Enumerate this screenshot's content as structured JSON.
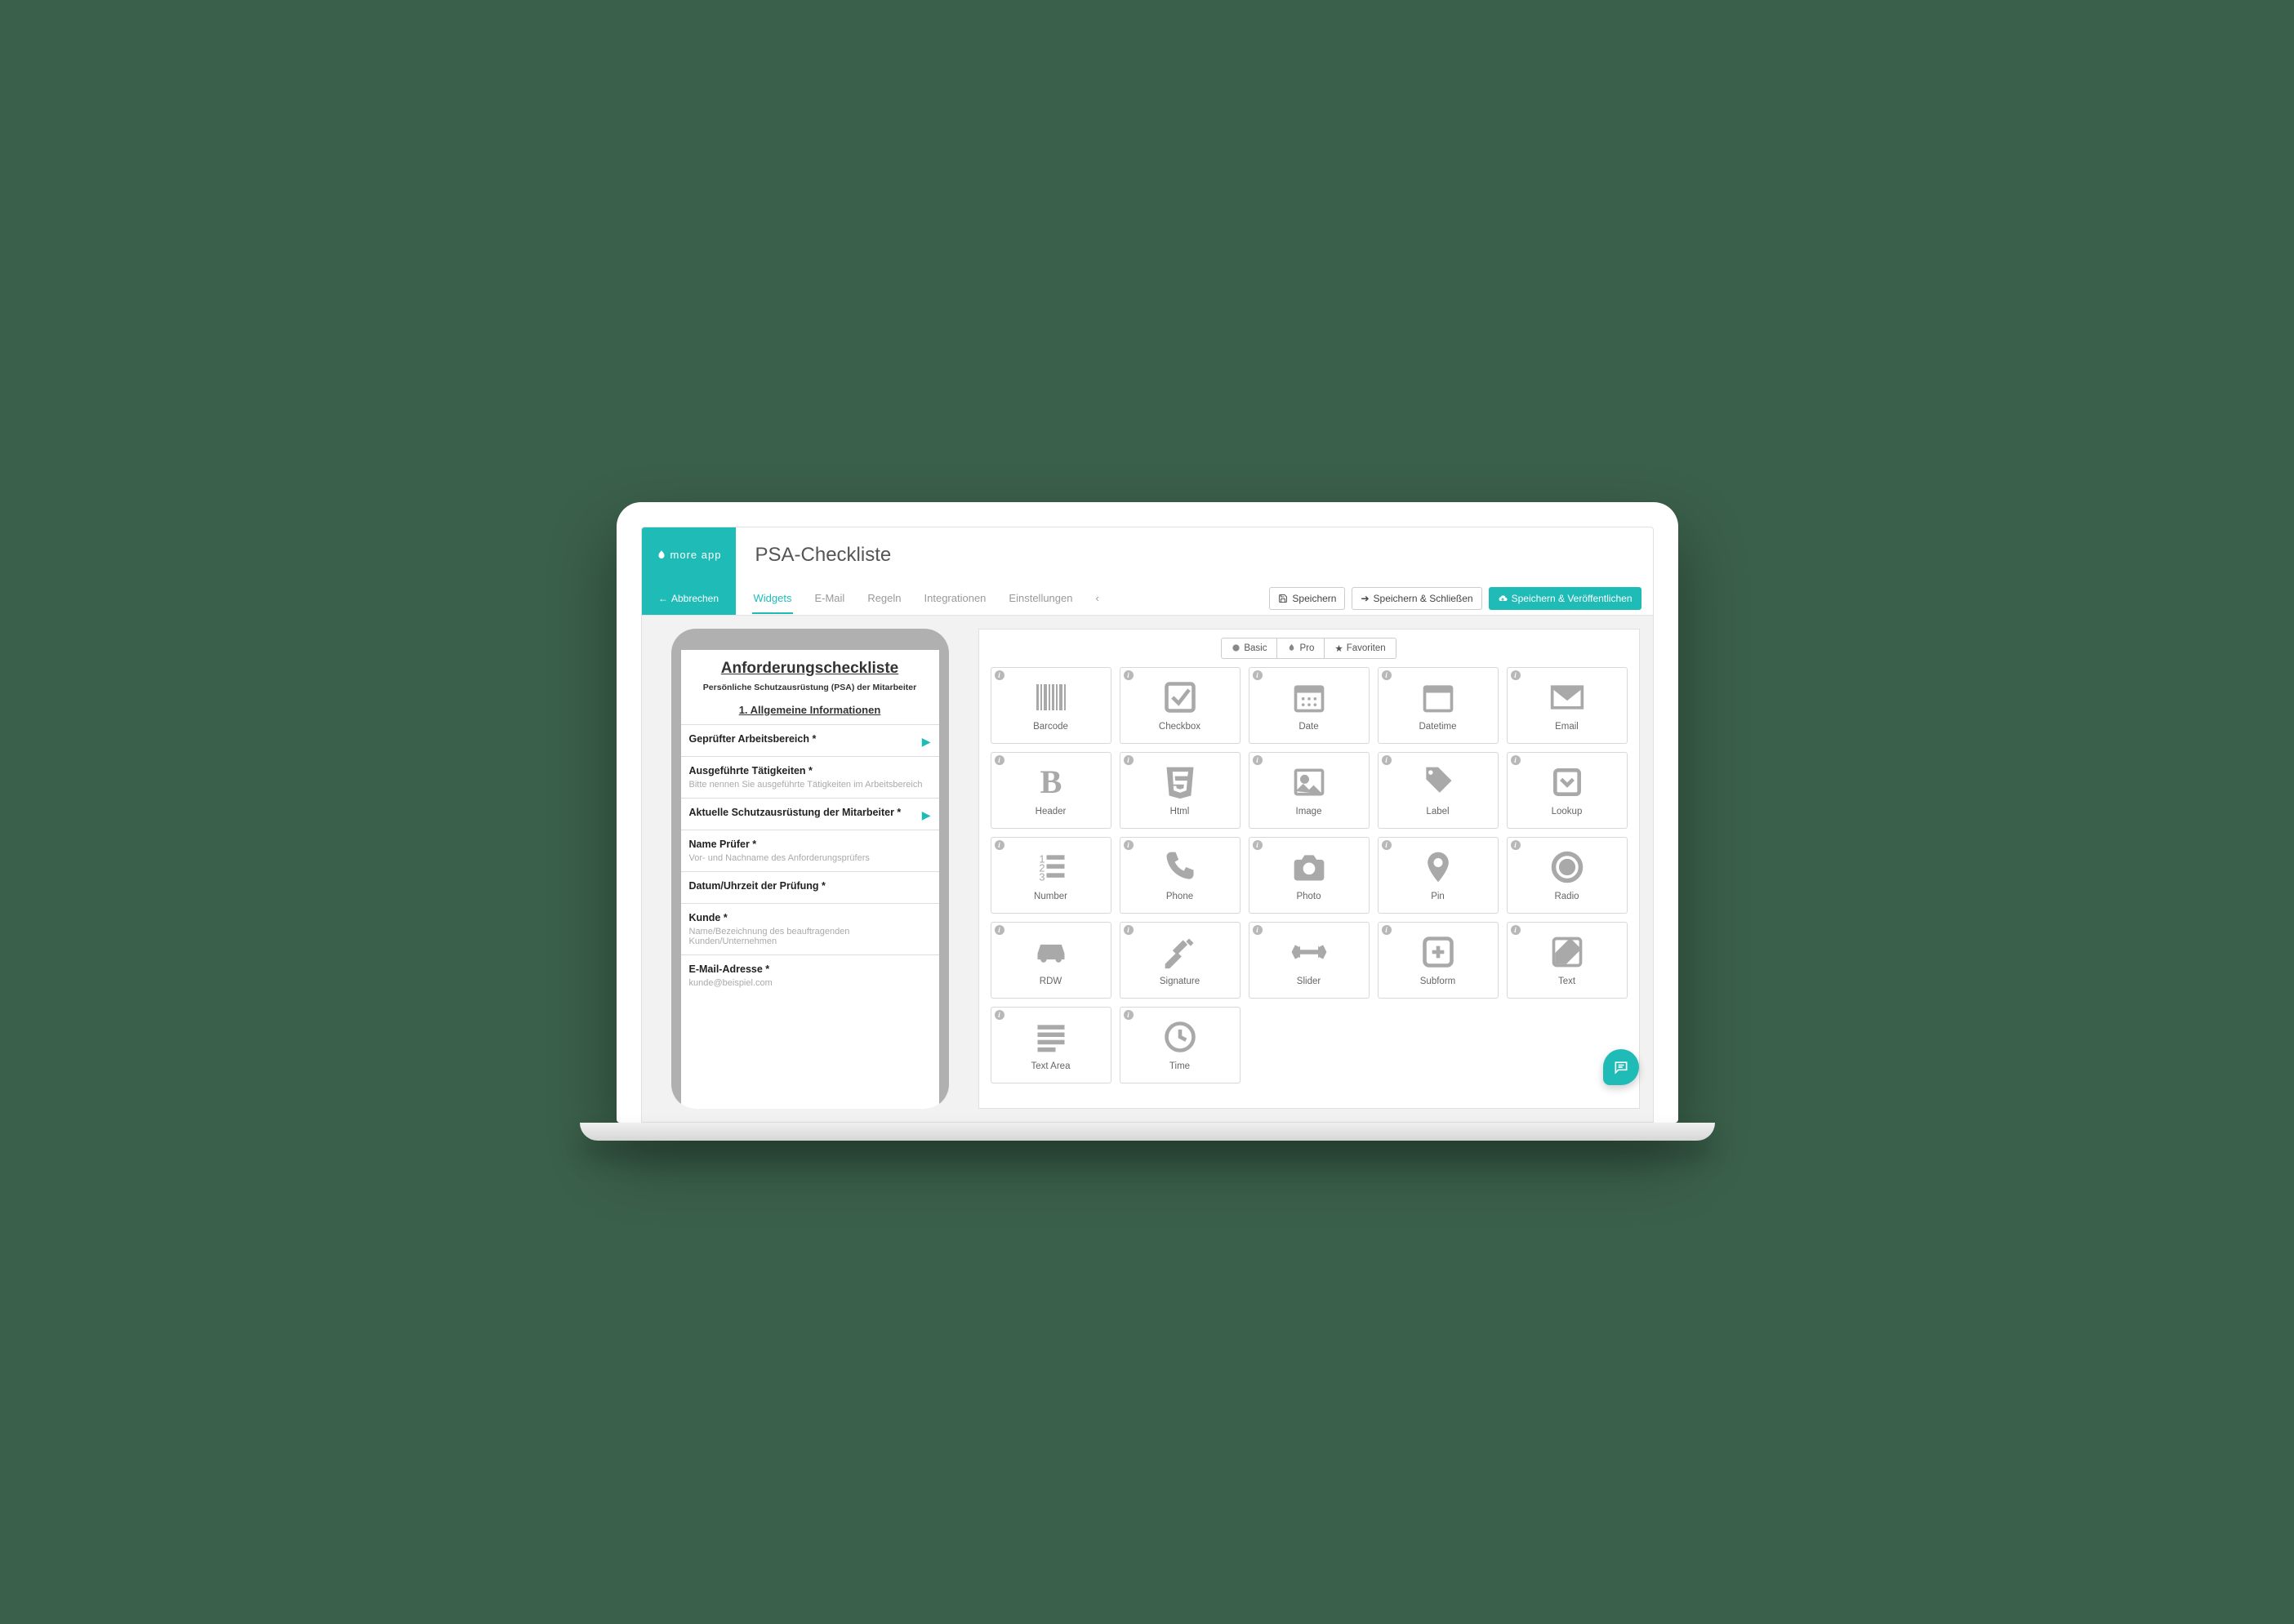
{
  "brand": "more app",
  "page_title": "PSA-Checkliste",
  "cancel_label": "Abbrechen",
  "tabs": {
    "widgets": "Widgets",
    "email": "E-Mail",
    "rules": "Regeln",
    "integrations": "Integrationen",
    "settings": "Einstellungen"
  },
  "actions": {
    "save": "Speichern",
    "save_close": "Speichern & Schließen",
    "save_publish": "Speichern & Veröffentlichen"
  },
  "form": {
    "title": "Anforderungscheckliste",
    "subtitle": "Persönliche Schutzausrüstung (PSA) der Mitarbeiter",
    "section1": "1. Allgemeine Informationen",
    "fields": [
      {
        "label": "Geprüfter Arbeitsbereich *",
        "hint": "",
        "chevron": true
      },
      {
        "label": "Ausgeführte Tätigkeiten *",
        "hint": "Bitte nennen Sie ausgeführte Tätigkeiten im Arbeitsbereich",
        "chevron": false
      },
      {
        "label": "Aktuelle Schutzausrüstung der Mitarbeiter *",
        "hint": "",
        "chevron": true
      },
      {
        "label": "Name Prüfer *",
        "hint": "Vor- und Nachname des Anforderungsprüfers",
        "chevron": false
      },
      {
        "label": "Datum/Uhrzeit der Prüfung *",
        "hint": "",
        "chevron": false
      },
      {
        "label": "Kunde *",
        "hint": "Name/Bezeichnung des beauftragenden Kunden/Unternehmen",
        "chevron": false
      },
      {
        "label": "E-Mail-Adresse *",
        "hint": "kunde@beispiel.com",
        "chevron": false
      }
    ]
  },
  "widget_tabs": {
    "basic": "Basic",
    "pro": "Pro",
    "fav": "Favoriten"
  },
  "widgets": [
    "Barcode",
    "Checkbox",
    "Date",
    "Datetime",
    "Email",
    "Header",
    "Html",
    "Image",
    "Label",
    "Lookup",
    "Number",
    "Phone",
    "Photo",
    "Pin",
    "Radio",
    "RDW",
    "Signature",
    "Slider",
    "Subform",
    "Text",
    "Text Area",
    "Time"
  ]
}
